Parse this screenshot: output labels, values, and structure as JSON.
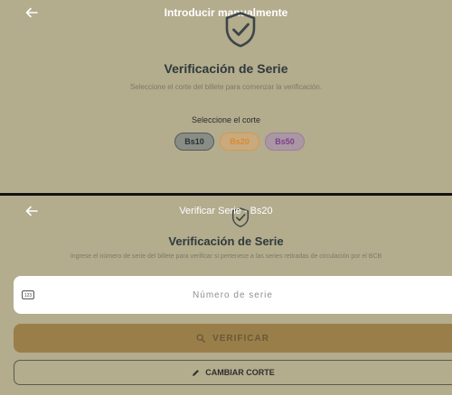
{
  "top_screen": {
    "appbar": {
      "title": "Introducir manualmente"
    },
    "heading": "Verificación de Serie",
    "subtitle": "Seleccione el corte del billete para comenzar la verificación.",
    "cut_label": "Seleccione el corte",
    "chips": [
      {
        "label": "Bs10",
        "color": "#243238"
      },
      {
        "label": "Bs20",
        "color": "#d98a2a"
      },
      {
        "label": "Bs50",
        "color": "#7c3f8a"
      }
    ]
  },
  "bottom_screen": {
    "appbar": {
      "title": "Verificar Serie - Bs20"
    },
    "heading": "Verificación de Serie",
    "subtitle": "Ingrese el número de serie del billete para verificar si pertenece a las series retiradas de circulación por el BCB",
    "serial_input": {
      "placeholder": "Número de serie",
      "value": ""
    },
    "verify_button": {
      "label": "VERIFICAR",
      "icon": "search-icon"
    },
    "change_button": {
      "label": "CAMBIAR CORTE",
      "icon": "edit-icon"
    }
  },
  "colors": {
    "background": "#b3ac8d",
    "heading": "#2f3a3c",
    "verify_button": "#9a7e4a"
  }
}
